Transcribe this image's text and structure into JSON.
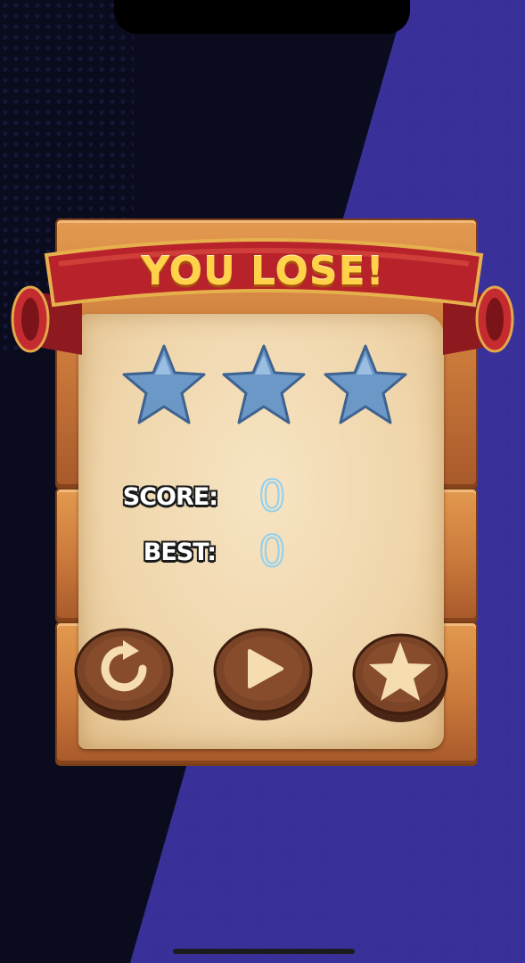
{
  "game": {
    "title": "YOU LOSE!",
    "stars_earned": 0,
    "stars_total": 3,
    "score_label": "SCORE:",
    "score_value": "0",
    "best_label": "BEST:",
    "best_value": "0"
  },
  "buttons": {
    "replay_icon": "replay-icon",
    "play_icon": "play-icon",
    "rate_icon": "star-icon"
  },
  "colors": {
    "background_dark": "#0a0c1e",
    "background_purple": "#3a309a",
    "ribbon_red": "#b8222a",
    "title_yellow": "#ffd24a",
    "star_blue": "#7aa6d4",
    "button_brown": "#6b3a22",
    "icon_cream": "#f5ddb0",
    "value_outline": "#8fd0f0"
  }
}
